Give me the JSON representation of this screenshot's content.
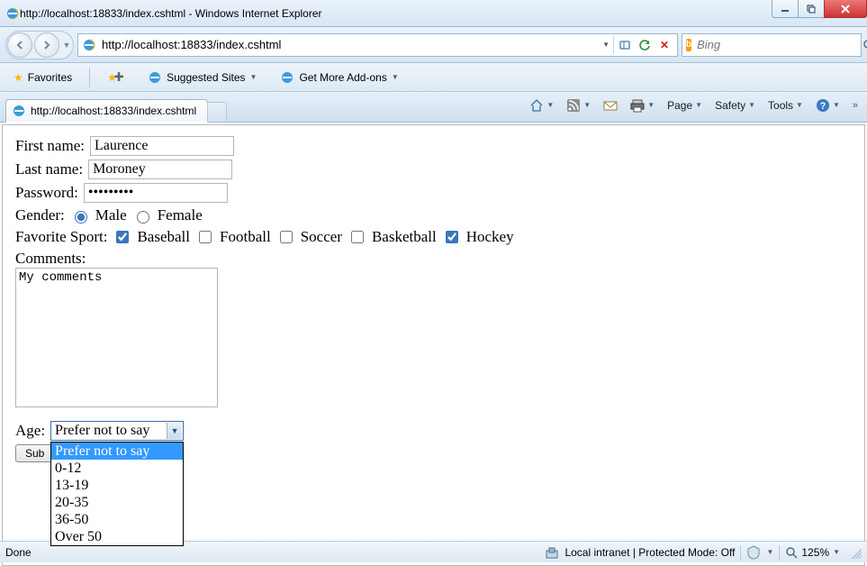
{
  "window": {
    "title": "http://localhost:18833/index.cshtml - Windows Internet Explorer"
  },
  "address": {
    "url": "http://localhost:18833/index.cshtml",
    "search_placeholder": "Bing"
  },
  "favbar": {
    "favorites": "Favorites",
    "suggested": "Suggested Sites",
    "addons": "Get More Add-ons"
  },
  "tab": {
    "title": "http://localhost:18833/index.cshtml"
  },
  "cmdbar": {
    "page": "Page",
    "safety": "Safety",
    "tools": "Tools"
  },
  "form": {
    "first_label": "First name:",
    "first_value": "Laurence",
    "last_label": "Last name:",
    "last_value": "Moroney",
    "password_label": "Password:",
    "password_value": "•••••••••",
    "gender_label": "Gender:",
    "male": "Male",
    "female": "Female",
    "sport_label": "Favorite Sport:",
    "baseball": "Baseball",
    "football": "Football",
    "soccer": "Soccer",
    "basketball": "Basketball",
    "hockey": "Hockey",
    "comments_label": "Comments:",
    "comments_value": "My comments",
    "age_label": "Age:",
    "age_selected": "Prefer not to say",
    "age_options": [
      "Prefer not to say",
      "0-12",
      "13-19",
      "20-35",
      "36-50",
      "Over 50"
    ],
    "submit": "Sub"
  },
  "status": {
    "done": "Done",
    "zone": "Local intranet | Protected Mode: Off",
    "zoom": "125%"
  }
}
